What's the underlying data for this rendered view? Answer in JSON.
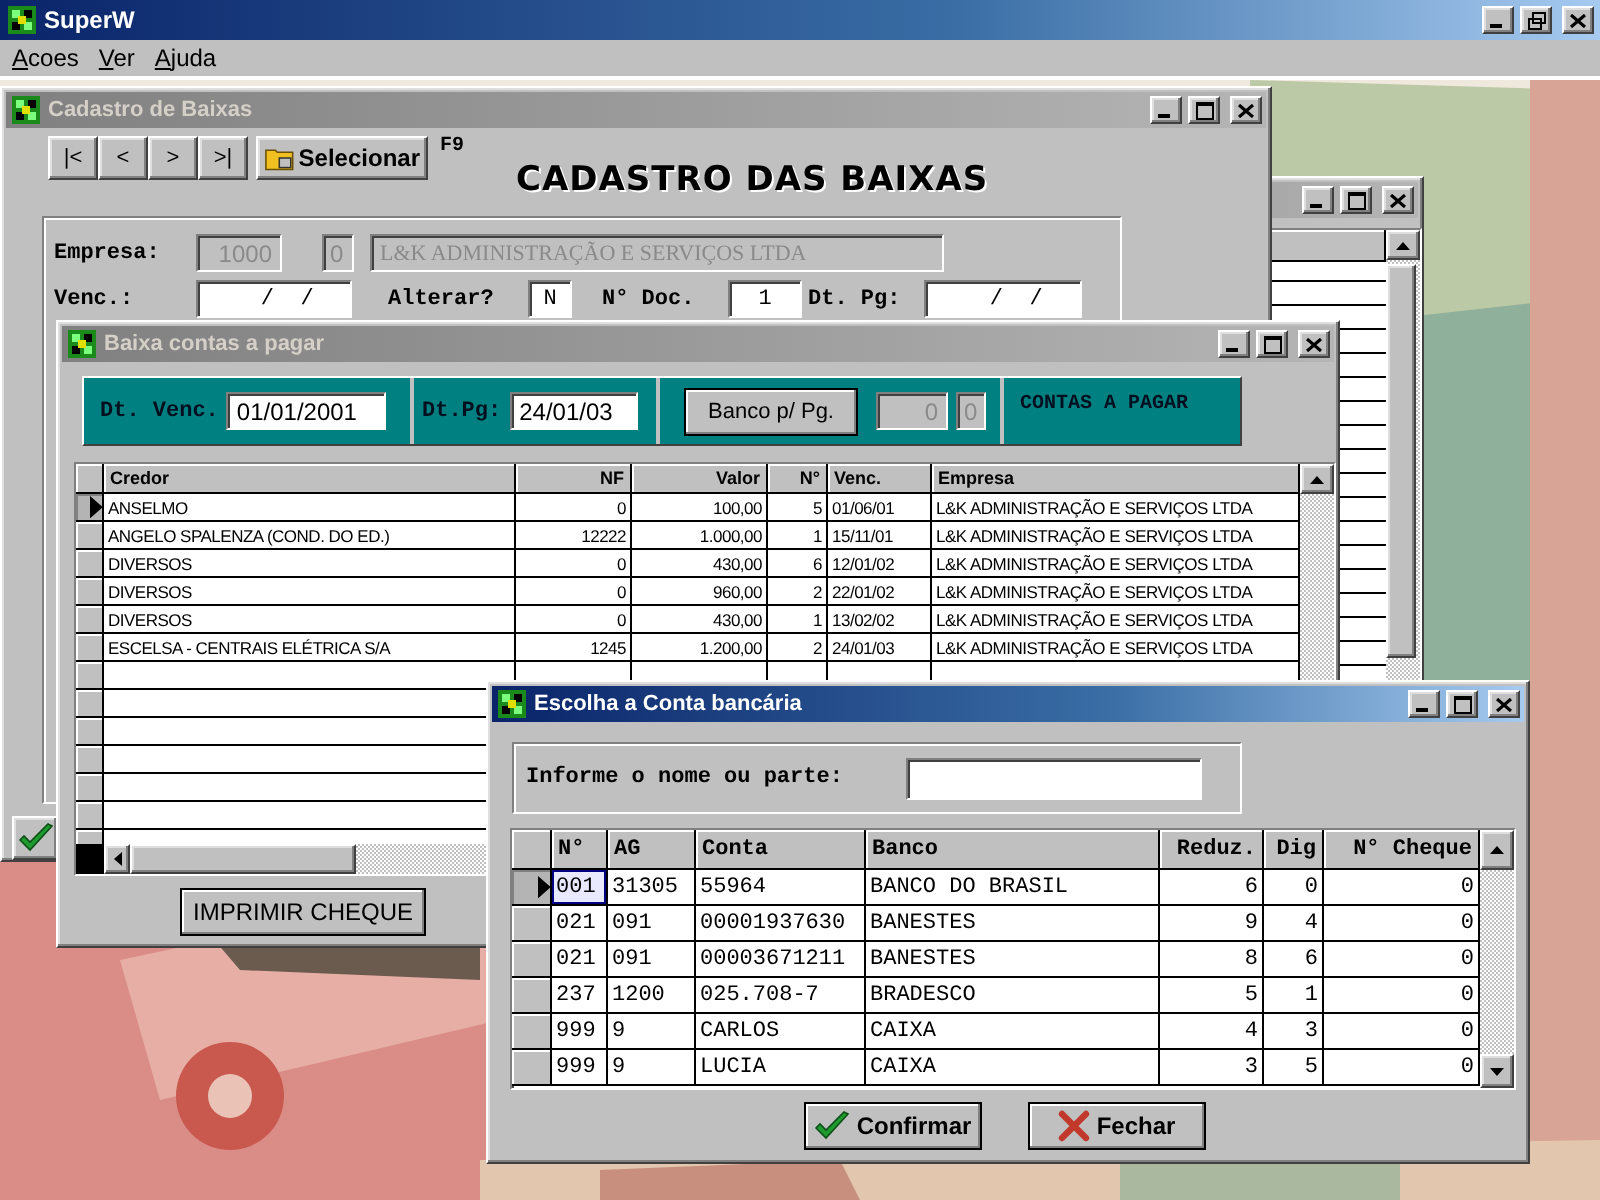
{
  "app": {
    "title": "SuperW"
  },
  "menu": [
    {
      "label": "Acoes"
    },
    {
      "label": "Ver"
    },
    {
      "label": "Ajuda"
    }
  ],
  "back_window": {
    "active": false
  },
  "cadastro": {
    "title": "Cadastro de Baixas",
    "active": false,
    "nav": [
      "|<",
      "<",
      ">",
      ">|"
    ],
    "select_button": "Selecionar",
    "shortcut": "F9",
    "heading": "CADASTRO DAS BAIXAS",
    "company": {
      "label": "Empresa:",
      "code": "1000",
      "branch": "0",
      "name": "L&K ADMINISTRAÇÃO E SERVIÇOS LTDA"
    },
    "fields": [
      {
        "label": "Venc.:",
        "value": "  /  /"
      },
      {
        "label": "Alterar?",
        "value": "N"
      },
      {
        "label": "N° Doc.",
        "value": "1"
      },
      {
        "label": "Dt. Pg:",
        "value": "  /  /"
      }
    ]
  },
  "contas": {
    "title": "Baixa contas a pagar",
    "active": false,
    "due_label": "Dt. Venc.",
    "due_value": "01/01/2001",
    "pay_label": "Dt.Pg:",
    "pay_value": "24/01/03",
    "bank_button": "Banco p/ Pg.",
    "bank_code": "0",
    "bank_digit": "0",
    "caption": "CONTAS A PAGAR",
    "columns": [
      "Credor",
      "NF",
      "Valor",
      "N°",
      "Venc.",
      "Empresa"
    ],
    "rows": [
      {
        "selected": true,
        "cells": [
          "ANSELMO",
          "0",
          "100,00",
          "5",
          "01/06/01",
          "L&K ADMINISTRAÇÃO E SERVIÇOS LTDA"
        ]
      },
      {
        "selected": false,
        "cells": [
          "ANGELO SPALENZA (COND. DO ED.)",
          "12222",
          "1.000,00",
          "1",
          "15/11/01",
          "L&K ADMINISTRAÇÃO E SERVIÇOS LTDA"
        ]
      },
      {
        "selected": false,
        "cells": [
          "DIVERSOS",
          "0",
          "430,00",
          "6",
          "12/01/02",
          "L&K ADMINISTRAÇÃO E SERVIÇOS LTDA"
        ]
      },
      {
        "selected": false,
        "cells": [
          "DIVERSOS",
          "0",
          "960,00",
          "2",
          "22/01/02",
          "L&K ADMINISTRAÇÃO E SERVIÇOS LTDA"
        ]
      },
      {
        "selected": false,
        "cells": [
          "DIVERSOS",
          "0",
          "430,00",
          "1",
          "13/02/02",
          "L&K ADMINISTRAÇÃO E SERVIÇOS LTDA"
        ]
      },
      {
        "selected": false,
        "cells": [
          "ESCELSA - CENTRAIS ELÉTRICA S/A",
          "1245",
          "1.200,00",
          "2",
          "24/01/03",
          "L&K ADMINISTRAÇÃO E SERVIÇOS LTDA"
        ]
      }
    ],
    "print_button": "IMPRIMIR CHEQUE"
  },
  "banco": {
    "title": "Escolha a Conta bancária",
    "active": true,
    "search_label": "Informe o nome ou parte:",
    "columns": [
      "N°",
      "AG",
      "Conta",
      "Banco",
      "Reduz.",
      "Dig",
      "N° Cheque"
    ],
    "rows": [
      {
        "selected": true,
        "cells": [
          "001",
          "31305",
          "55964",
          "BANCO DO BRASIL",
          "6",
          "0",
          "0"
        ]
      },
      {
        "selected": false,
        "cells": [
          "021",
          "091",
          "00001937630",
          "BANESTES",
          "9",
          "4",
          "0"
        ]
      },
      {
        "selected": false,
        "cells": [
          "021",
          "091",
          "00003671211",
          "BANESTES",
          "8",
          "6",
          "0"
        ]
      },
      {
        "selected": false,
        "cells": [
          "237",
          "1200",
          "025.708-7",
          "BRADESCO",
          "5",
          "1",
          "0"
        ]
      },
      {
        "selected": false,
        "cells": [
          "999",
          "9",
          "CARLOS",
          "CAIXA",
          "4",
          "3",
          "0"
        ]
      },
      {
        "selected": false,
        "cells": [
          "999",
          "9",
          "LUCIA",
          "CAIXA",
          "3",
          "5",
          "0"
        ]
      }
    ],
    "buttons": [
      {
        "label": "Confirmar",
        "kind": "confirm"
      },
      {
        "label": "Fechar",
        "kind": "close"
      }
    ]
  }
}
